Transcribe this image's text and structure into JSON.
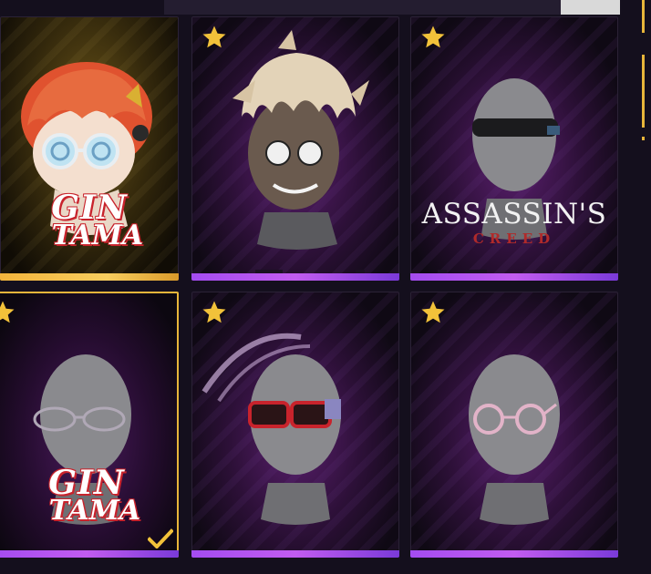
{
  "grid": {
    "items": [
      {
        "id": "item-1",
        "type": "character-head",
        "starred": false,
        "rarity": "gold",
        "selected": false,
        "brand": "gintama-1"
      },
      {
        "id": "item-2",
        "type": "spiky-hair-mask",
        "starred": true,
        "rarity": "purple",
        "selected": false,
        "brand": null
      },
      {
        "id": "item-3",
        "type": "blindfold",
        "starred": true,
        "rarity": "purple",
        "selected": false,
        "brand": "assassins-creed"
      },
      {
        "id": "item-4",
        "type": "oval-glasses",
        "starred": true,
        "rarity": "purple",
        "selected": true,
        "brand": "gintama-2"
      },
      {
        "id": "item-5",
        "type": "red-visor-glasses",
        "starred": true,
        "rarity": "purple",
        "selected": false,
        "brand": null
      },
      {
        "id": "item-6",
        "type": "round-pink-glasses",
        "starred": true,
        "rarity": "purple",
        "selected": false,
        "brand": null
      }
    ]
  },
  "brands": {
    "gintama_1": {
      "line1": "GIN",
      "line2": "TAMA"
    },
    "gintama_2": {
      "line1": "GIN",
      "line2": "TAMA"
    },
    "assassins_creed": {
      "main": "ASSASSIN'S",
      "sub": "CREED"
    }
  },
  "icons": {
    "star": "star-icon",
    "check": "check-icon"
  },
  "colors": {
    "accent_gold": "#e8b53a",
    "rarity_purple": "#a44cf0",
    "rarity_gold": "#f2b43c",
    "background": "#140f1d"
  }
}
